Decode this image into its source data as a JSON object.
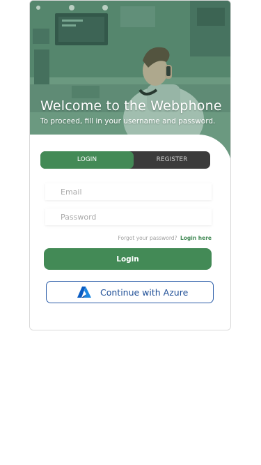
{
  "hero": {
    "title": "Welcome to the Webphone",
    "subtitle": "To proceed, fill in your username and password."
  },
  "tabs": {
    "login": "LOGIN",
    "register": "REGISTER",
    "active": "login"
  },
  "form": {
    "email_placeholder": "Email",
    "email_value": "",
    "password_placeholder": "Password",
    "password_value": "",
    "forgot_text": "Forgot your password?",
    "forgot_link": "Login here",
    "login_button": "Login",
    "azure_button": "Continue with Azure"
  },
  "colors": {
    "accent": "#438a56",
    "tab_inactive_bg": "#3b3b3b",
    "azure_blue": "#1e4e96",
    "hero_tint": "#6f9a84"
  },
  "icons": {
    "azure": "azure-logo-icon",
    "hero_image": "man-on-phone-cafe-photo"
  }
}
